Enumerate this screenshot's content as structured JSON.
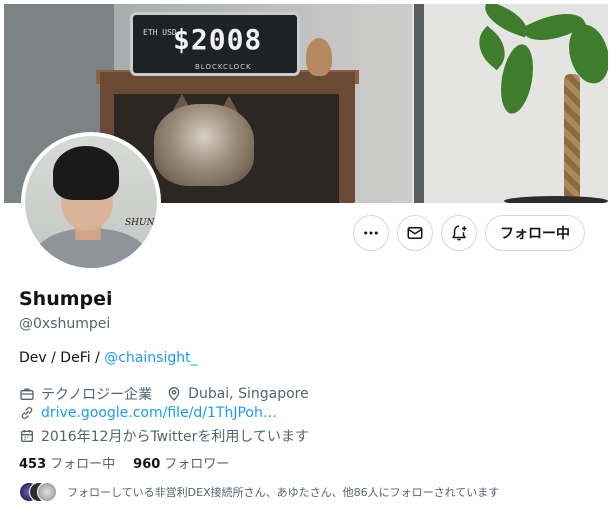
{
  "banner": {
    "clock_display": "$2008",
    "clock_small": "ETH USD",
    "clock_label": "BLOCKCLOCK"
  },
  "avatar": {
    "signature": "SHUN"
  },
  "actions": {
    "more_icon": "more-dots-icon",
    "message_icon": "mail-icon",
    "notify_icon": "bell-plus-icon",
    "follow_label": "フォロー中"
  },
  "profile": {
    "name": "Shumpei",
    "handle": "@0xshumpei",
    "bio_prefix": "Dev / DeFi / ",
    "bio_mention": "@chainsight_",
    "category": "テクノロジー企業",
    "location": "Dubai, Singapore",
    "link": "drive.google.com/file/d/1ThJPoh…",
    "joined": "2016年12月からTwitterを利用しています"
  },
  "counts": {
    "following_count": "453",
    "following_label": "フォロー中",
    "followers_count": "960",
    "followers_label": "フォロワー"
  },
  "followed_by": {
    "text": "フォローしている非営利DEX接続所さん、あゆたさん、他86人にフォローされています"
  },
  "colors": {
    "accent": "#1d9bf0",
    "text_primary": "#0f1419",
    "text_secondary": "#536471",
    "border": "#cfd9de"
  }
}
